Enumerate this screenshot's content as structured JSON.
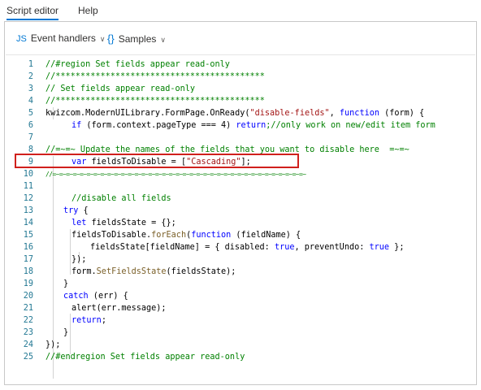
{
  "tabs": {
    "active": "Script editor",
    "other": "Help"
  },
  "toolbar": {
    "event_handlers": {
      "icon": "JS",
      "label": "Event handlers",
      "chevron": "∨"
    },
    "samples": {
      "icon": "{}",
      "label": "Samples",
      "chevron": "∨"
    }
  },
  "colors": {
    "accent": "#0078d4",
    "highlight_border": "#d0201c",
    "line_number": "#237893",
    "comment": "#008000",
    "string": "#a31515",
    "keyword": "#0000ff"
  },
  "editor": {
    "lines": [
      {
        "n": "1"
      },
      {
        "n": "2"
      },
      {
        "n": "3"
      },
      {
        "n": "4"
      },
      {
        "n": "5"
      },
      {
        "n": "6"
      },
      {
        "n": "7"
      },
      {
        "n": "8"
      },
      {
        "n": "9"
      },
      {
        "n": "10"
      },
      {
        "n": "11"
      },
      {
        "n": "12"
      },
      {
        "n": "13"
      },
      {
        "n": "14"
      },
      {
        "n": "15"
      },
      {
        "n": "16"
      },
      {
        "n": "17"
      },
      {
        "n": "18"
      },
      {
        "n": "19"
      },
      {
        "n": "20"
      },
      {
        "n": "21"
      },
      {
        "n": "22"
      },
      {
        "n": "23"
      },
      {
        "n": "24"
      },
      {
        "n": "25"
      }
    ],
    "code": {
      "l1": "//#region Set fields appear read-only",
      "l2": "//******************************************",
      "l3": "// Set fields appear read-only",
      "l4": "//******************************************",
      "l5_obj": "kwizcom.ModernUILibrary.FormPage.OnReady(",
      "l5_str": "\"disable-fields\"",
      "l5_sep": ", ",
      "l5_kw": "function",
      "l5_rest": " (form) {",
      "l6_kw": "if",
      "l6_a": " (form.context.pageType === 4) ",
      "l6_ret": "return",
      "l6_cmt": ";//only work on new/edit item form",
      "l8": "//=~=~ Update the names of the fields that you want to disable here  =~=~",
      "l9_kw": "var",
      "l9_a": " fieldsToDisable = [",
      "l9_str": "\"Cascading\"",
      "l9_b": "];",
      "l10": "//=~=~=~=~=~=~=~=~=~=~=~=~=~=~=~=~=~=~=~=~=~=~=~=~=~=~=~=~=~=~=~=~=~=~=~=~=~",
      "l12": "//disable all fields",
      "l13_kw": "try",
      "l13_b": " {",
      "l14_kw": "let",
      "l14_a": " fieldsState = {};",
      "l15_a": "fieldsToDisable.",
      "l15_fn": "forEach",
      "l15_b": "(",
      "l15_kw": "function",
      "l15_c": " (fieldName) {",
      "l16_a": "fieldsState[fieldName] = { disabled: ",
      "l16_t1": "true",
      "l16_b": ", preventUndo: ",
      "l16_t2": "true",
      "l16_c": " };",
      "l17": "});",
      "l18_a": "form.",
      "l18_fn": "SetFieldsState",
      "l18_b": "(fieldsState);",
      "l19": "}",
      "l20_kw": "catch",
      "l20_a": " (err) {",
      "l21": "alert(err.message);",
      "l22_kw": "return",
      "l22_a": ";",
      "l23": "}",
      "l24": "});",
      "l25": "//#endregion Set fields appear read-only"
    }
  }
}
